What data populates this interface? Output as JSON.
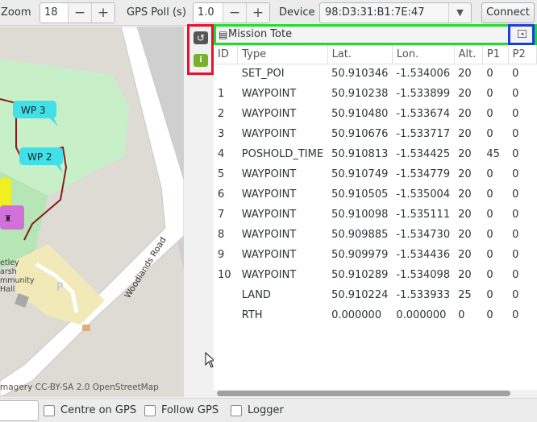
{
  "toolbar": {
    "zoom_label": "Zoom",
    "zoom_value": "18",
    "gps_poll_label": "GPS Poll (s)",
    "gps_poll_value": "1.0",
    "minus": "−",
    "plus": "+",
    "device_label": "Device",
    "device_value": "98:D3:31:B1:7E:47",
    "connect_label": "Connect"
  },
  "map": {
    "waypoint_labels": [
      "WP 3",
      "WP 2"
    ],
    "road_label": "Woodlands Road",
    "place_label_lines": [
      "etley",
      "arsh",
      "mmunity",
      "Hall"
    ],
    "parking_label": "P",
    "attribution": "magery CC-BY-SA 2.0 OpenStreetMap"
  },
  "panel": {
    "title": "Mission Tote",
    "columns": [
      "ID",
      "Type",
      "Lat.",
      "Lon.",
      "Alt.",
      "P1",
      "P2"
    ],
    "rows": [
      [
        "",
        "SET_POI",
        "50.910346",
        "-1.534006",
        "20",
        "0",
        "0"
      ],
      [
        "1",
        "WAYPOINT",
        "50.910238",
        "-1.533899",
        "20",
        "0",
        "0"
      ],
      [
        "2",
        "WAYPOINT",
        "50.910480",
        "-1.533674",
        "20",
        "0",
        "0"
      ],
      [
        "3",
        "WAYPOINT",
        "50.910676",
        "-1.533717",
        "20",
        "0",
        "0"
      ],
      [
        "4",
        "POSHOLD_TIME",
        "50.910813",
        "-1.534425",
        "20",
        "45",
        "0"
      ],
      [
        "5",
        "WAYPOINT",
        "50.910749",
        "-1.534779",
        "20",
        "0",
        "0"
      ],
      [
        "6",
        "WAYPOINT",
        "50.910505",
        "-1.535004",
        "20",
        "0",
        "0"
      ],
      [
        "7",
        "WAYPOINT",
        "50.910098",
        "-1.535111",
        "20",
        "0",
        "0"
      ],
      [
        "8",
        "WAYPOINT",
        "50.909885",
        "-1.534730",
        "20",
        "0",
        "0"
      ],
      [
        "9",
        "WAYPOINT",
        "50.909979",
        "-1.534436",
        "20",
        "0",
        "0"
      ],
      [
        "10",
        "WAYPOINT",
        "50.910289",
        "-1.534098",
        "20",
        "0",
        "0"
      ],
      [
        "",
        "LAND",
        "50.910224",
        "-1.533933",
        "25",
        "0",
        "0"
      ],
      [
        "",
        "RTH",
        "0.000000",
        "0.000000",
        "0",
        "0",
        "0"
      ]
    ]
  },
  "bottombar": {
    "centre_on_gps": "Centre on GPS",
    "follow_gps": "Follow GPS",
    "logger": "Logger"
  },
  "colors": {
    "side_tools_highlight": "#e8102f",
    "title_highlight": "#18e028",
    "dock_highlight": "#1e3de0",
    "waypoint_marker": "#3fe0e8",
    "route_line": "#8b1a1a"
  }
}
